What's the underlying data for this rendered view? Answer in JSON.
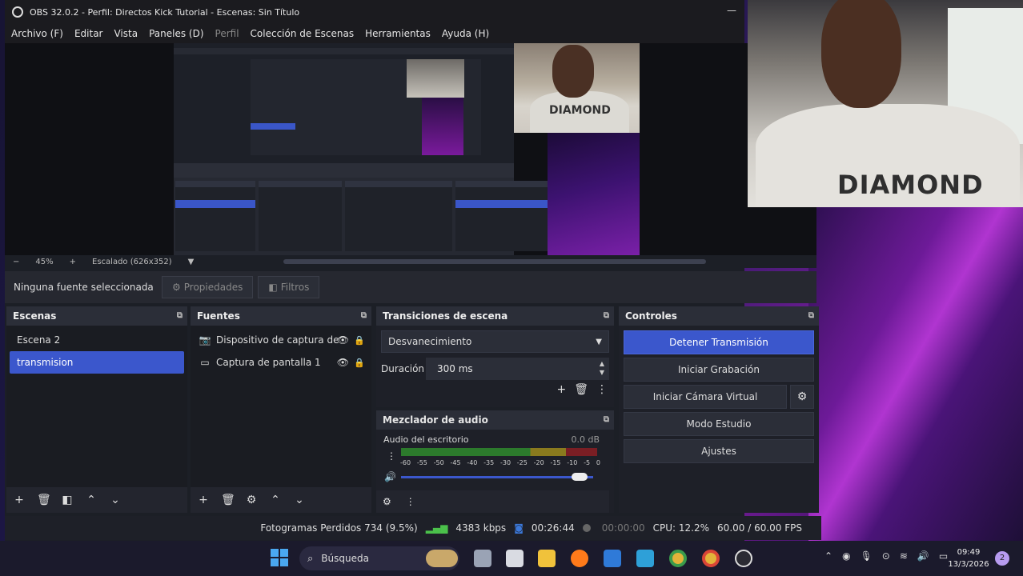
{
  "window": {
    "title": "OBS 32.0.2 - Perfil: Directos Kick Tutorial - Escenas: Sin Título",
    "minimize_glyph": "—"
  },
  "menu": [
    "Archivo (F)",
    "Editar",
    "Vista",
    "Paneles (D)",
    "Perfil",
    "Colección de Escenas",
    "Herramientas",
    "Ayuda (H)"
  ],
  "preview": {
    "camera_text_small": "DIAMOND",
    "camera_text_large": "DIAMOND",
    "zoom_minus": "−",
    "zoom_plus": "+",
    "zoom": "45%",
    "scaling": "Escalado (626x352)"
  },
  "props_bar": {
    "no_source": "Ninguna fuente seleccionada",
    "properties": "Propiedades",
    "filters": "Filtros"
  },
  "scenes": {
    "title": "Escenas",
    "items": [
      "Escena 2",
      "transmision"
    ],
    "selected_index": 1
  },
  "sources": {
    "title": "Fuentes",
    "items": [
      {
        "label": "Dispositivo de captura de",
        "icon": "camera-icon"
      },
      {
        "label": "Captura de pantalla 1",
        "icon": "monitor-icon"
      }
    ]
  },
  "transitions": {
    "title": "Transiciones de escena",
    "type": "Desvanecimiento",
    "duration_label": "Duración",
    "duration_value": "300 ms"
  },
  "mixer": {
    "title": "Mezclador de audio",
    "channel": "Audio del escritorio",
    "db": "0.0 dB",
    "ticks": [
      "-60",
      "-55",
      "-50",
      "-45",
      "-40",
      "-35",
      "-30",
      "-25",
      "-20",
      "-15",
      "-10",
      "-5",
      "0"
    ],
    "volume_level": 0.97
  },
  "controls": {
    "title": "Controles",
    "stop_stream": "Detener Transmisión",
    "start_recording": "Iniciar Grabación",
    "start_virtualcam": "Iniciar Cámara Virtual",
    "studio_mode": "Modo Estudio",
    "settings": "Ajustes"
  },
  "status": {
    "dropped_frames": "Fotogramas Perdidos 734 (9.5%)",
    "bitrate": "4383 kbps",
    "live_time": "00:26:44",
    "rec_time": "00:00:00",
    "cpu": "CPU: 12.2%",
    "fps": "60.00 / 60.00 FPS"
  },
  "taskbar": {
    "search": "Búsqueda",
    "time": "09:49",
    "date": "13/3/2026",
    "notifications": "2"
  },
  "colors": {
    "accent": "#3b57cc",
    "panel": "#1e2028",
    "header": "#2b2e38"
  }
}
